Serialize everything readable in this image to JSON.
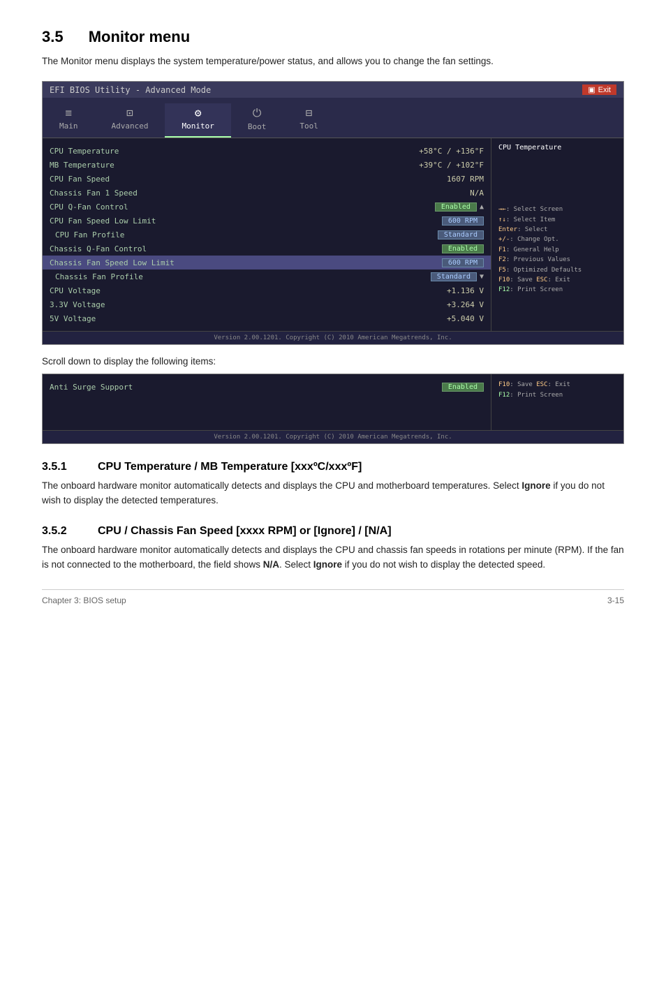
{
  "section": {
    "number": "3.5",
    "title": "Monitor menu",
    "description": "The Monitor menu displays the system temperature/power status, and allows you to change the fan settings."
  },
  "bios_main": {
    "titlebar": "EFI BIOS Utility - Advanced Mode",
    "exit_label": "Exit",
    "nav_items": [
      {
        "icon": "≡≡",
        "label": "Main",
        "active": false
      },
      {
        "icon": "⊡",
        "label": "Advanced",
        "active": false
      },
      {
        "icon": "CE",
        "label": "Monitor",
        "active": true
      },
      {
        "icon": "⏻",
        "label": "Boot",
        "active": false
      },
      {
        "icon": "⊟",
        "label": "Tool",
        "active": false
      }
    ],
    "rows": [
      {
        "label": "CPU Temperature",
        "value": "+58°C / +136°F",
        "type": "plain"
      },
      {
        "label": "MB Temperature",
        "value": "+39°C / +102°F",
        "type": "plain"
      },
      {
        "label": "CPU Fan Speed",
        "value": "1607 RPM",
        "type": "plain"
      },
      {
        "label": "Chassis Fan 1 Speed",
        "value": "N/A",
        "type": "plain"
      },
      {
        "label": "CPU Q-Fan Control",
        "value": "Enabled",
        "type": "badge-green"
      },
      {
        "label": "CPU Fan Speed Low Limit",
        "value": "600 RPM",
        "type": "badge-rpm"
      },
      {
        "label": "CPU Fan Profile",
        "value": "Standard",
        "type": "badge-standard"
      },
      {
        "label": "Chassis Q-Fan Control",
        "value": "Enabled",
        "type": "badge-green"
      },
      {
        "label": "Chassis Fan Speed Low Limit",
        "value": "600 RPM",
        "type": "badge-rpm"
      },
      {
        "label": "Chassis Fan Profile",
        "value": "Standard",
        "type": "badge-standard"
      },
      {
        "label": "CPU Voltage",
        "value": "+1.136 V",
        "type": "plain"
      },
      {
        "label": "3.3V Voltage",
        "value": "+3.264 V",
        "type": "plain"
      },
      {
        "label": "5V Voltage",
        "value": "+5.040 V",
        "type": "plain"
      }
    ],
    "right_panel_title": "CPU Temperature",
    "help_lines": [
      "→←: Select Screen",
      "↑↓: Select Item",
      "Enter: Select",
      "+/-: Change Opt.",
      "F1: General Help",
      "F2: Previous Values",
      "F5: Optimized Defaults",
      "F10: Save  ESC: Exit",
      "F12: Print Screen"
    ],
    "footer": "Version 2.00.1201. Copyright (C) 2010 American Megatrends, Inc."
  },
  "scroll_note": "Scroll down to display the following items:",
  "bios_small": {
    "rows": [
      {
        "label": "Anti Surge Support",
        "value": "Enabled",
        "type": "badge-green"
      }
    ],
    "help_lines_top": [
      "F10: Save  ESC: Exit",
      "F12: Print Screen"
    ],
    "footer": "Version 2.00.1201. Copyright (C) 2010 American Megatrends, Inc."
  },
  "subsections": [
    {
      "number": "3.5.1",
      "title": "CPU Temperature / MB Temperature [xxxºC/xxxºF]",
      "body": "The onboard hardware monitor automatically detects and displays the CPU and motherboard temperatures. Select <b>Ignore</b> if you do not wish to display the detected temperatures."
    },
    {
      "number": "3.5.2",
      "title": "CPU / Chassis Fan Speed [xxxx RPM] or [Ignore] / [N/A]",
      "body": "The onboard hardware monitor automatically detects and displays the CPU and chassis fan speeds in rotations per minute (RPM). If the fan is not connected to the motherboard, the field shows <b>N/A</b>. Select <b>Ignore</b> if you do not wish to display the detected speed."
    }
  ],
  "footer": {
    "chapter": "Chapter 3: BIOS setup",
    "page": "3-15"
  }
}
